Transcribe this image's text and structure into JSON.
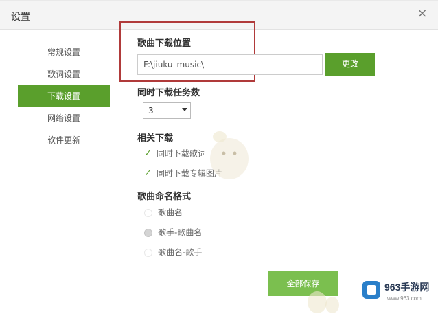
{
  "window": {
    "title": "设置",
    "close_symbol": "×"
  },
  "sidebar": {
    "items": [
      {
        "label": "常规设置",
        "active": false
      },
      {
        "label": "歌词设置",
        "active": false
      },
      {
        "label": "下载设置",
        "active": true
      },
      {
        "label": "网络设置",
        "active": false
      },
      {
        "label": "软件更新",
        "active": false
      }
    ]
  },
  "download_location": {
    "heading": "歌曲下载位置",
    "path_value": "F:\\jiuku_music\\",
    "change_button": "更改"
  },
  "concurrent_tasks": {
    "heading": "同时下载任务数",
    "selected_value": "3"
  },
  "related_downloads": {
    "heading": "相关下载",
    "options": [
      {
        "label": "同时下载歌词",
        "checked": true,
        "check_mark": "✓"
      },
      {
        "label": "同时下载专辑图片",
        "checked": true,
        "check_mark": "✓"
      }
    ]
  },
  "naming_format": {
    "heading": "歌曲命名格式",
    "options": [
      {
        "label": "歌曲名",
        "selected": false
      },
      {
        "label": "歌手-歌曲名",
        "selected": true
      },
      {
        "label": "歌曲名-歌手",
        "selected": false
      }
    ]
  },
  "footer": {
    "save_all_button": "全部保存"
  },
  "watermark": {
    "brand": "963手游网",
    "url": "www.963.com"
  },
  "colors": {
    "accent": "#5a9f2c",
    "highlight_box": "#b03a3a",
    "save_button": "#7bbf4f"
  }
}
